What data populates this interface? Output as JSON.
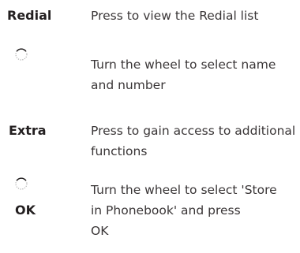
{
  "instructions": [
    {
      "key_text": "Redial",
      "description": "Press to view the Redial list"
    },
    {
      "key_icon": "wheel-icon",
      "description": "Turn the wheel to select name and number"
    },
    {
      "key_text": "Extra",
      "description": "Press to gain access to additional functions"
    },
    {
      "key_icon": "wheel-icon",
      "key_text": "OK",
      "description_lines": [
        "Turn the wheel to select 'Store",
        "in Phonebook' and press",
        "OK"
      ]
    }
  ]
}
